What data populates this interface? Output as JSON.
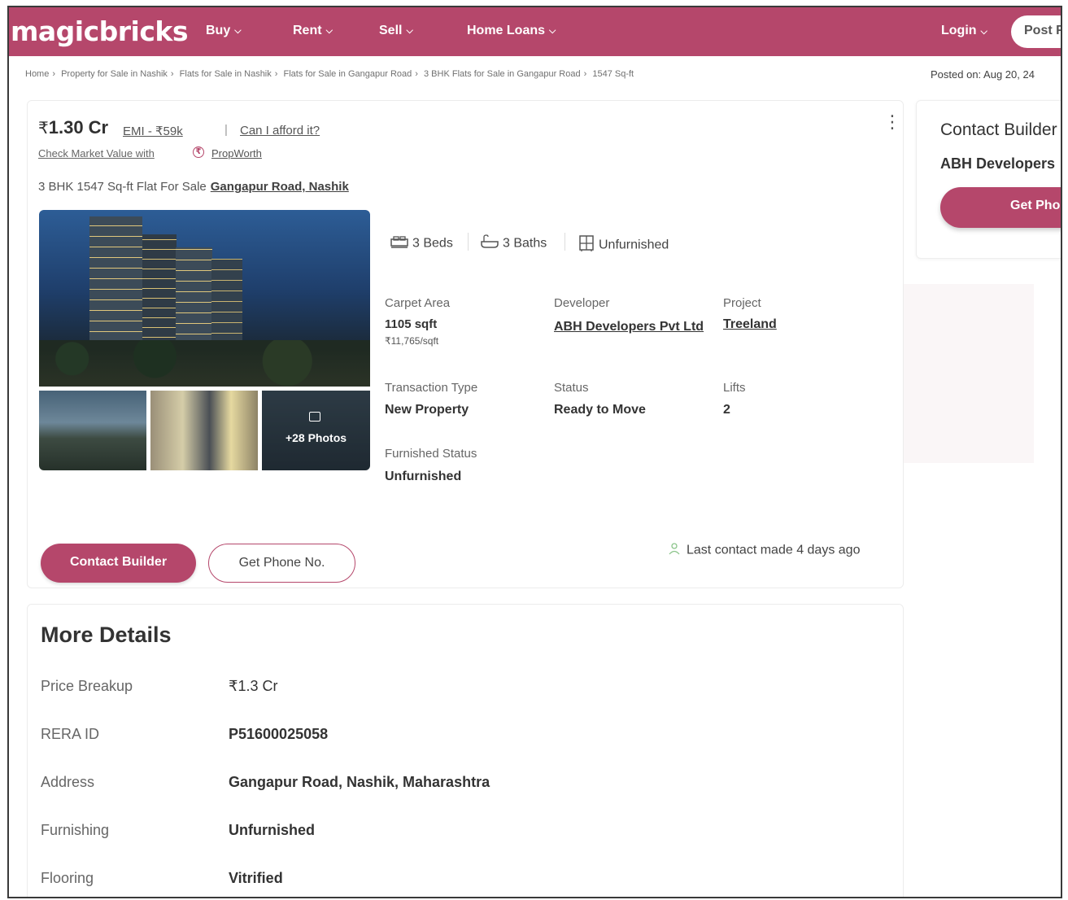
{
  "header": {
    "logo": "magicbricks",
    "nav": [
      {
        "label": "Buy"
      },
      {
        "label": "Rent"
      },
      {
        "label": "Sell"
      },
      {
        "label": "Home Loans"
      }
    ],
    "login": "Login",
    "post": "Post F",
    "brand_color": "#b5476b"
  },
  "breadcrumb": {
    "items": [
      "Home",
      "Property for Sale in Nashik",
      "Flats for Sale in Nashik",
      "Flats for Sale in Gangapur Road",
      "3 BHK Flats for Sale in Gangapur Road",
      "1547 Sq-ft"
    ],
    "posted": "Posted on: Aug 20, 24"
  },
  "listing": {
    "price": "1.30 Cr",
    "currency_symbol": "₹",
    "emi": "EMI - ₹59k",
    "afford": "Can I afford it?",
    "market_value": "Check Market Value with",
    "propworth": "PropWorth",
    "title": "3 BHK 1547 Sq-ft Flat For Sale",
    "location": "Gangapur Road, Nashik",
    "more_photos": "+28 Photos",
    "amenities": {
      "beds": "3 Beds",
      "baths": "3 Baths",
      "furnishing": "Unfurnished"
    },
    "details": {
      "carpet_area_label": "Carpet Area",
      "carpet_area_value": "1105 sqft",
      "carpet_area_rate": "₹11,765/sqft",
      "developer_label": "Developer",
      "developer_value": "ABH Developers Pvt Ltd",
      "project_label": "Project",
      "project_value": "Treeland",
      "transaction_label": "Transaction Type",
      "transaction_value": "New Property",
      "status_label": "Status",
      "status_value": "Ready to Move",
      "lifts_label": "Lifts",
      "lifts_value": "2",
      "furnished_label": "Furnished Status",
      "furnished_value": "Unfurnished"
    },
    "contact_builder": "Contact Builder",
    "get_phone": "Get Phone No.",
    "last_contact": "Last contact made 4 days ago"
  },
  "side_card": {
    "title": "Contact Builder",
    "developer": "ABH Developers",
    "button": "Get Phone No."
  },
  "more_details": {
    "heading": "More Details",
    "rows": [
      {
        "label": "Price Breakup",
        "value": "₹1.3 Cr"
      },
      {
        "label": "RERA ID",
        "value": "P51600025058"
      },
      {
        "label": "Address",
        "value": "Gangapur Road, Nashik, Maharashtra"
      },
      {
        "label": "Furnishing",
        "value": "Unfurnished"
      },
      {
        "label": "Flooring",
        "value": "Vitrified"
      }
    ]
  }
}
